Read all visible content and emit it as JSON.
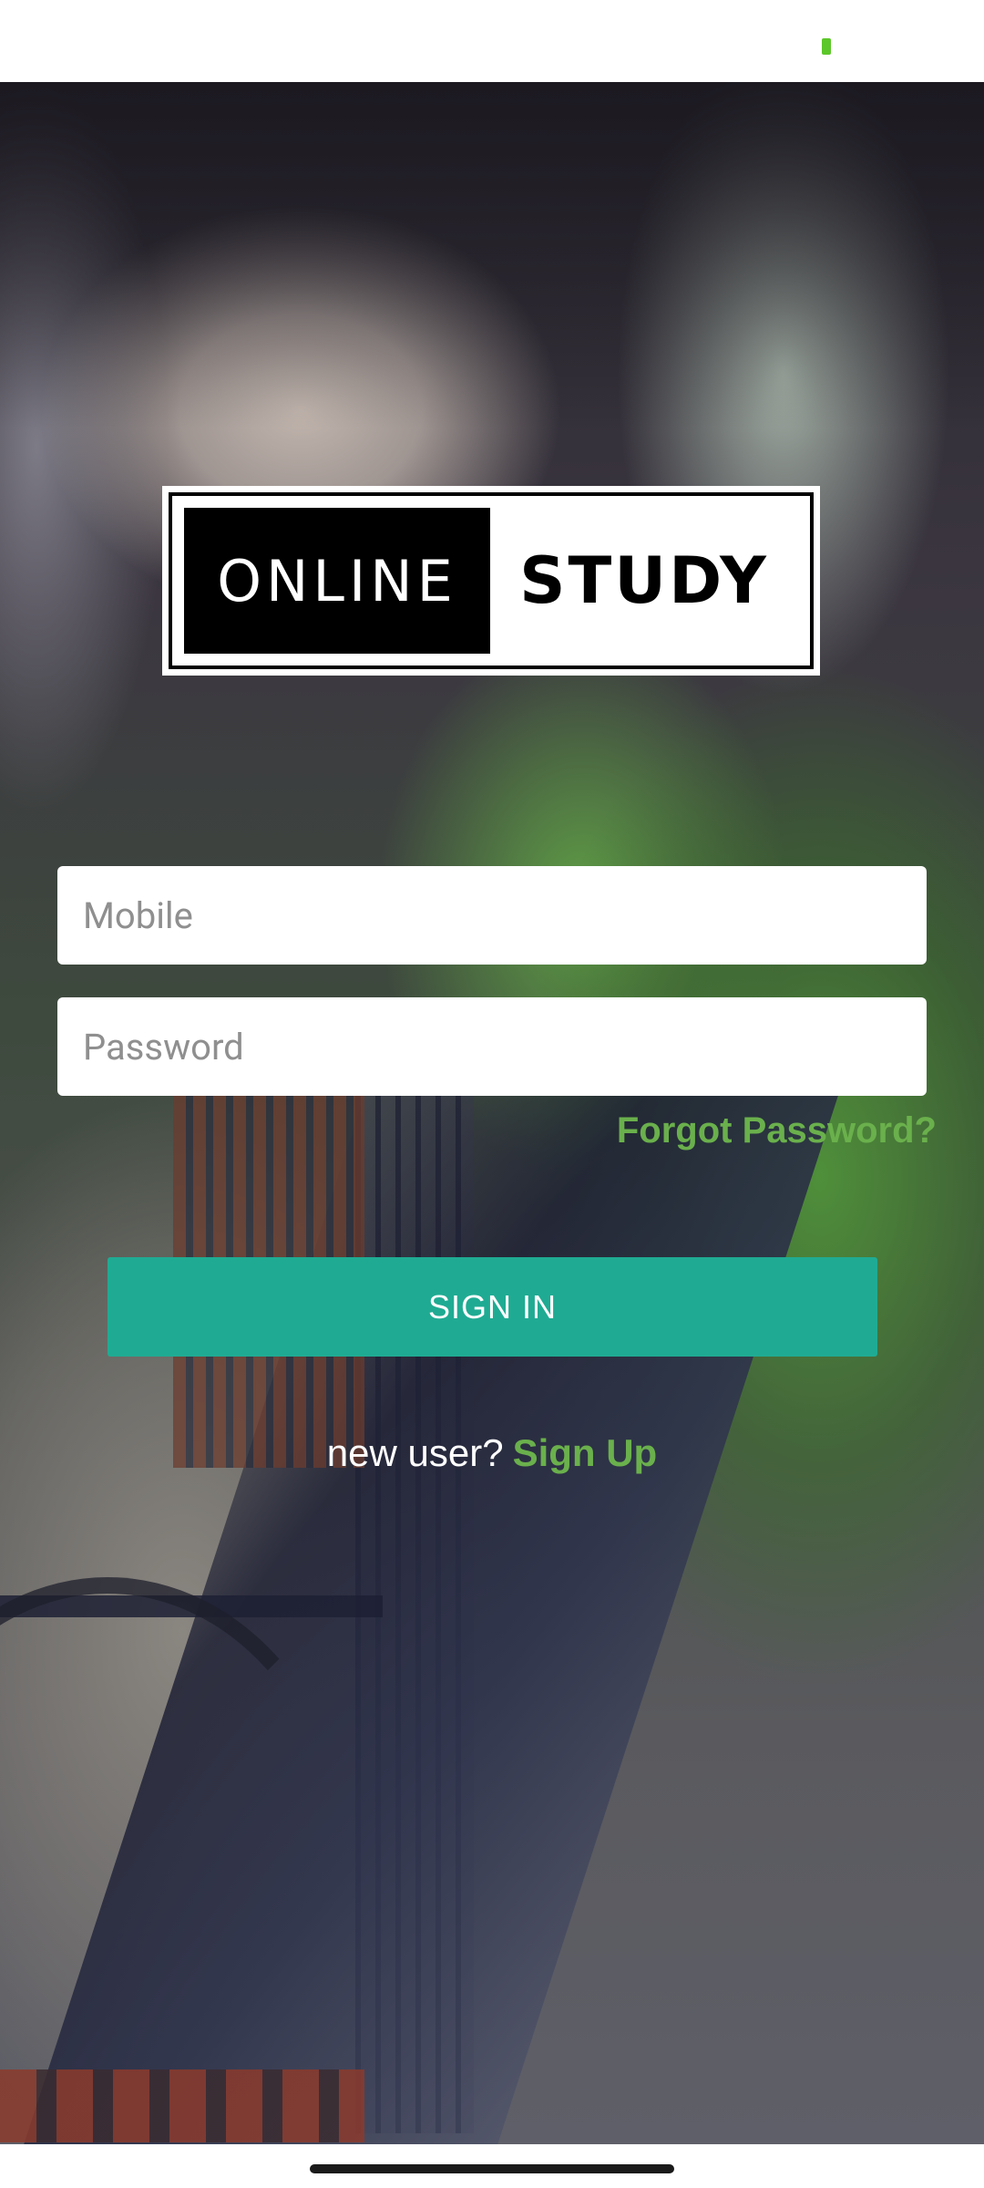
{
  "status_bar": {
    "battery_color": "#5cc72a"
  },
  "logo": {
    "left_text": "ONLINE",
    "right_text": "STUDY"
  },
  "form": {
    "mobile_placeholder": "Mobile",
    "password_placeholder": "Password",
    "forgot_password": "Forgot Password?",
    "signin_label": "SIGN IN"
  },
  "signup": {
    "prompt": "new user?",
    "link": "Sign Up"
  },
  "colors": {
    "accent_green": "#6ab04c",
    "button_teal": "#1fab93"
  }
}
